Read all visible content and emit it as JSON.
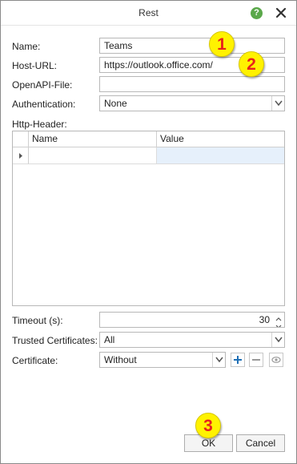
{
  "window": {
    "title": "Rest",
    "help_symbol": "?"
  },
  "form": {
    "name_label": "Name:",
    "name_value": "Teams",
    "host_label": "Host-URL:",
    "host_value": "https://outlook.office.com/",
    "openapi_label": "OpenAPI-File:",
    "openapi_value": "",
    "auth_label": "Authentication:",
    "auth_value": "None",
    "http_header_label": "Http-Header:",
    "headers_table": {
      "columns": [
        "Name",
        "Value"
      ],
      "rows": [
        [
          "",
          ""
        ]
      ]
    },
    "timeout_label": "Timeout (s):",
    "timeout_value": "30",
    "trusted_label": "Trusted Certificates:",
    "trusted_value": "All",
    "certificate_label": "Certificate:",
    "certificate_value": "Without"
  },
  "buttons": {
    "ok": "OK",
    "cancel": "Cancel"
  },
  "markers": [
    "1",
    "2",
    "3"
  ],
  "colors": {
    "marker_fill": "#fff200",
    "marker_text": "#e8231b",
    "help": "#5aa84a",
    "selected_cell": "#e6f0fb",
    "add_icon": "#1f6fb5"
  }
}
